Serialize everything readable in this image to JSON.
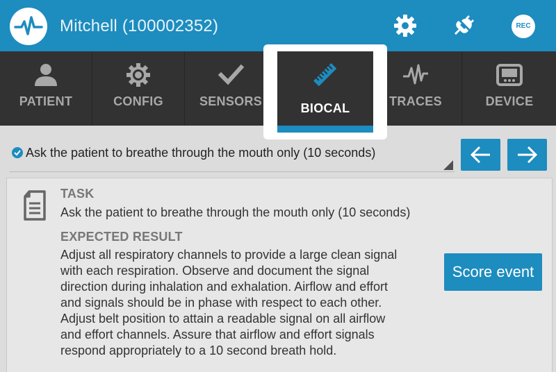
{
  "header": {
    "title": "Mitchell (100002352)",
    "icons": [
      "pulse-logo-icon",
      "gear-icon",
      "plug-icon"
    ],
    "rec_label": "REC"
  },
  "tabs": [
    {
      "label": "PATIENT",
      "icon": "person-icon"
    },
    {
      "label": "CONFIG",
      "icon": "gear-icon"
    },
    {
      "label": "SENSORS",
      "icon": "check-icon"
    },
    {
      "label": "BIOCAL",
      "icon": "ruler-icon",
      "active": true
    },
    {
      "label": "TRACES",
      "icon": "waveform-icon"
    },
    {
      "label": "DEVICE",
      "icon": "device-icon"
    }
  ],
  "step": {
    "selected": "Ask the patient to breathe through the mouth only (10 seconds)"
  },
  "task": {
    "task_heading": "TASK",
    "task_text": "Ask the patient to breathe through the mouth only (10 seconds)",
    "expected_heading": "EXPECTED RESULT",
    "expected_lines": [
      "Adjust all respiratory channels to provide a large clean signal",
      "with each respiration. Observe and document the signal",
      "direction during inhalation and exhalation. Airflow and effort",
      "and signals should be in phase with respect to each other.",
      "Adjust belt position to attain a readable signal on all airflow",
      "and effort channels. Assure that airflow and effort signals",
      "respond appropriately to a 10 second breath hold."
    ],
    "score_button": "Score event"
  },
  "colors": {
    "accent": "#1d8cbf",
    "tabbar": "#323232",
    "background": "#dcdcdc"
  }
}
